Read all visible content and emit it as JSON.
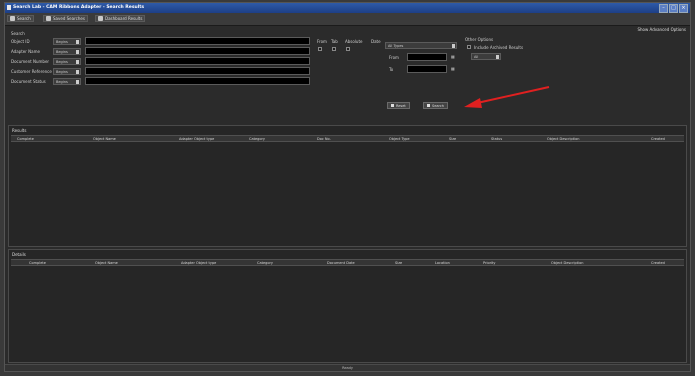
{
  "window": {
    "title": "Search Lab - CAM Ribbons Adapter - Search Results"
  },
  "toolbar": {
    "items": [
      "Search",
      "Saved Searches",
      "Dashboard Results"
    ]
  },
  "top_link": "Show Advanced Options",
  "query": {
    "section_label": "Search",
    "rows": [
      {
        "label": "Object ID",
        "mode": "Begins"
      },
      {
        "label": "Adapter Name",
        "mode": "Begins"
      },
      {
        "label": "Document Number",
        "mode": "Begins"
      },
      {
        "label": "Customer Reference",
        "mode": "Begins"
      },
      {
        "label": "Document Status",
        "mode": "Begins"
      }
    ],
    "range_labels": [
      "From",
      "Tab",
      "Absolute",
      "Date"
    ],
    "side": {
      "type_select": "All Types",
      "from_label": "From",
      "to_label": "To"
    },
    "options": {
      "title": "Other Options",
      "checkbox_label": "Include Archived Results",
      "select_value": "All"
    },
    "buttons": {
      "reset": "Reset",
      "search": "Search"
    }
  },
  "results": {
    "title": "Results",
    "columns": [
      "Complete",
      "Object Name",
      "Adapter Object type",
      "Category",
      "Doc No.",
      "Object Type",
      "Size",
      "Status",
      "Object Description",
      "Created"
    ]
  },
  "details": {
    "title": "Details",
    "columns": [
      "Complete",
      "Object Name",
      "Adapter Object type",
      "Category",
      "Document Date",
      "Size",
      "Location",
      "Priority",
      "Object Description",
      "Created"
    ]
  },
  "status": {
    "text": "Ready"
  },
  "colors": {
    "annotation_arrow": "#e02020",
    "titlebar": "#2e5aa8",
    "background": "#2b2b2b"
  }
}
